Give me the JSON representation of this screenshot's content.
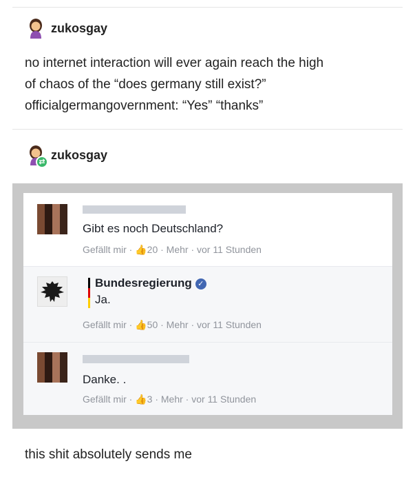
{
  "post": {
    "author": "zukosgay",
    "text_line1": "no internet interaction will ever again reach the high",
    "text_line2": "of chaos of the “does germany still exist?”",
    "text_line3": "officialgermangovernment: “Yes” “thanks”"
  },
  "reblog": {
    "author": "zukosgay",
    "footer": "this shit absolutely sends me"
  },
  "facebook": {
    "comments": [
      {
        "text": "Gibt es noch Deutschland?",
        "meta": "Gefällt mir · 👍20 · Mehr · vor 11 Stunden"
      },
      {
        "author": "Bundesregierung",
        "text": "Ja.",
        "meta": "Gefällt mir · 👍50 · Mehr · vor 11 Stunden"
      },
      {
        "text": "Danke. .",
        "meta": "Gefällt mir · 👍3 · Mehr · vor 11 Stunden"
      }
    ]
  },
  "icons": {
    "avatar": "woman-emoji-icon",
    "reblog": "reblog-icon",
    "verified": "verified-check-icon",
    "eagle": "federal-eagle-icon"
  },
  "colors": {
    "fb_frame": "#c8c8c8",
    "verified_blue": "#4267b2",
    "reblog_green": "#3ab86a",
    "meta_gray": "#90949c"
  }
}
